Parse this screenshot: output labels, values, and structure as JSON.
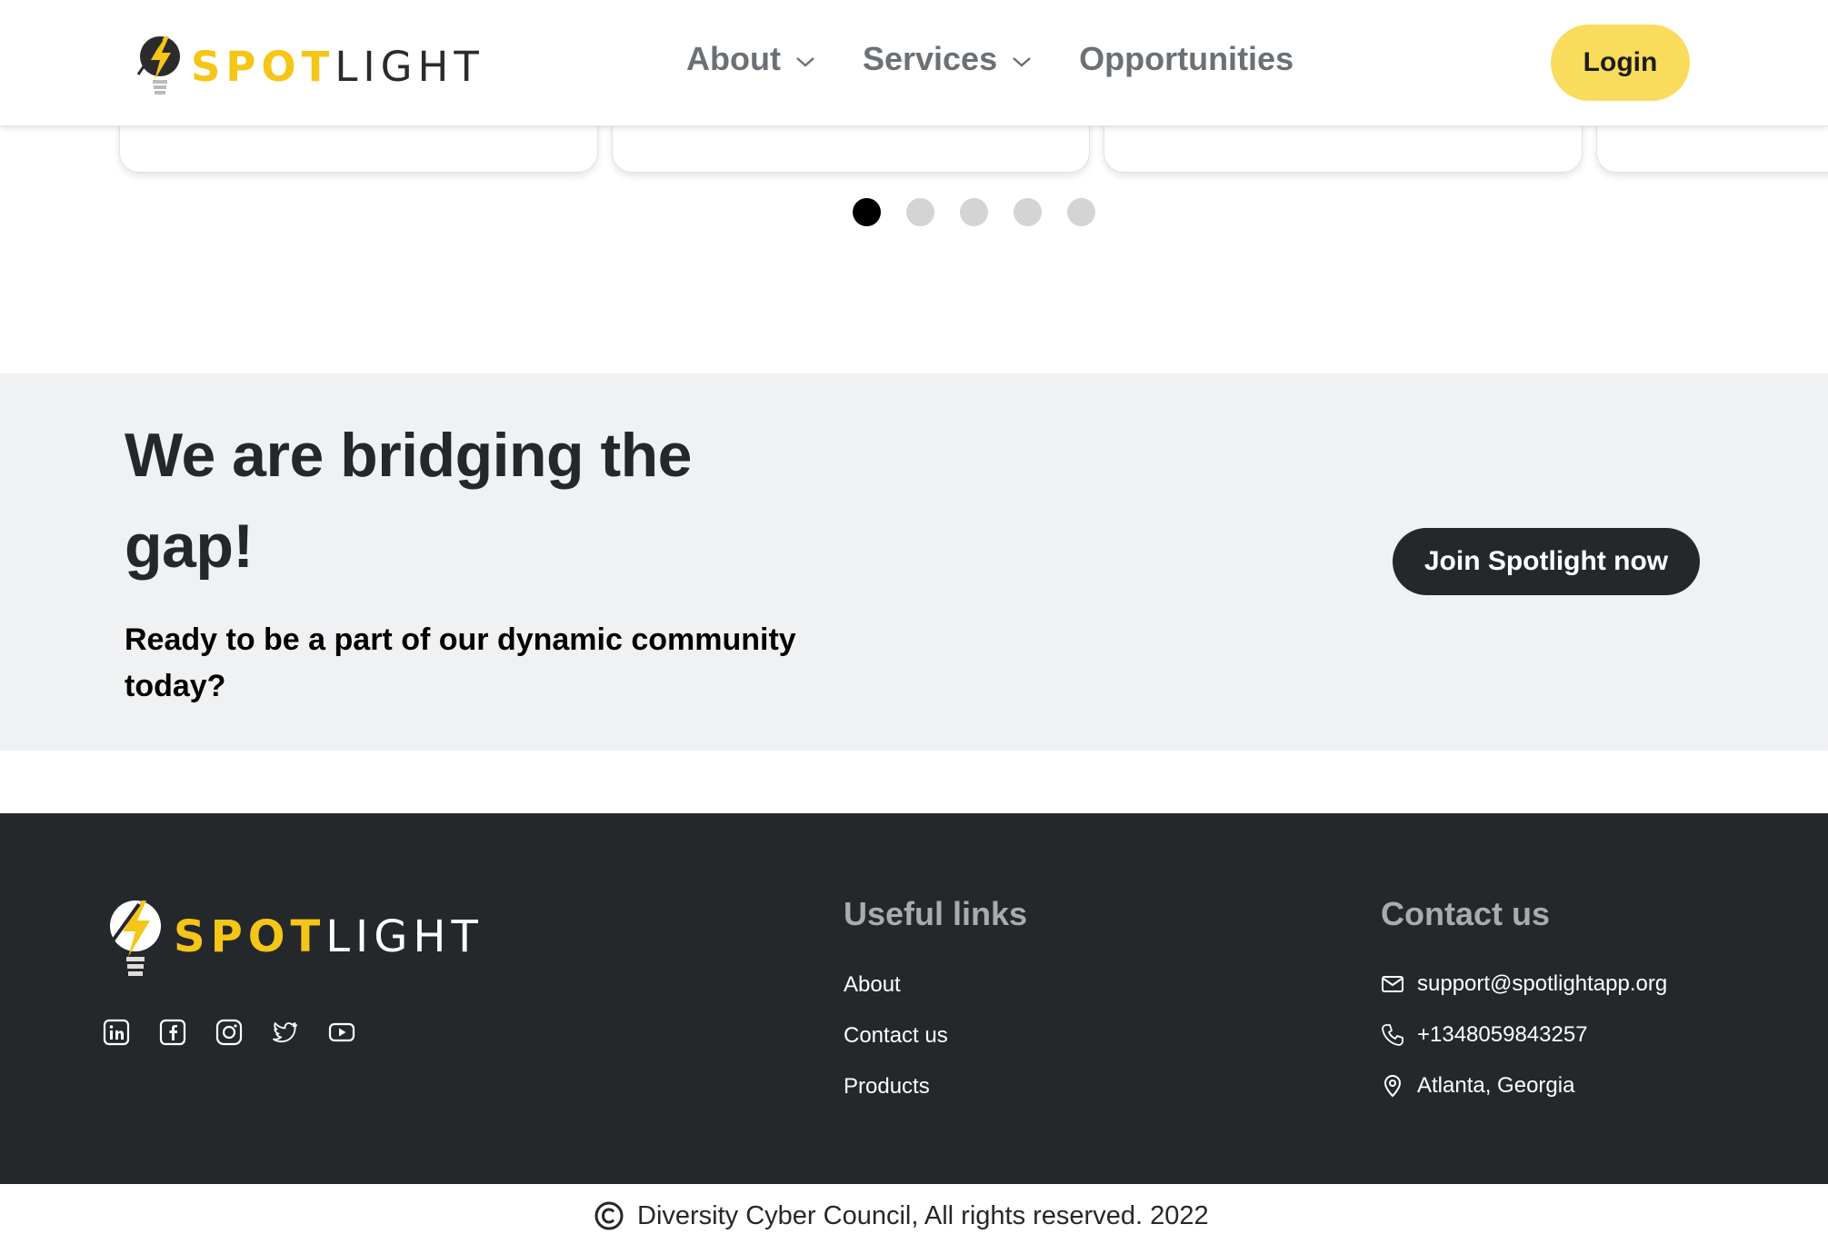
{
  "header": {
    "logo": {
      "spot": "SPOT",
      "light": "LIGHT"
    },
    "nav": [
      {
        "label": "About",
        "has_dropdown": true
      },
      {
        "label": "Services",
        "has_dropdown": true
      },
      {
        "label": "Opportunities",
        "has_dropdown": false
      }
    ],
    "login_label": "Login"
  },
  "carousel": {
    "active_index": 0,
    "total_dots": 5
  },
  "cta": {
    "title": "We are bridging the gap!",
    "subtitle": "Ready to be a part of our dynamic community today?",
    "button_label": "Join Spotlight now"
  },
  "footer": {
    "logo": {
      "spot": "SPOT",
      "light": "LIGHT"
    },
    "social_icons": [
      "linkedin-icon",
      "facebook-icon",
      "instagram-icon",
      "twitter-icon",
      "youtube-icon"
    ],
    "useful_links": {
      "title": "Useful links",
      "items": [
        "About",
        "Contact us",
        "Products"
      ]
    },
    "contact": {
      "title": "Contact us",
      "email": "support@spotlightapp.org",
      "phone": "+1348059843257",
      "location": "Atlanta, Georgia"
    }
  },
  "copyright": "Diversity Cyber Council, All rights reserved. 2022",
  "colors": {
    "brand_yellow": "#f9dc5c",
    "logo_yellow": "#f5c518",
    "dark": "#25282b",
    "band_gray": "#f0f1f3",
    "nav_gray": "#6b7075"
  }
}
